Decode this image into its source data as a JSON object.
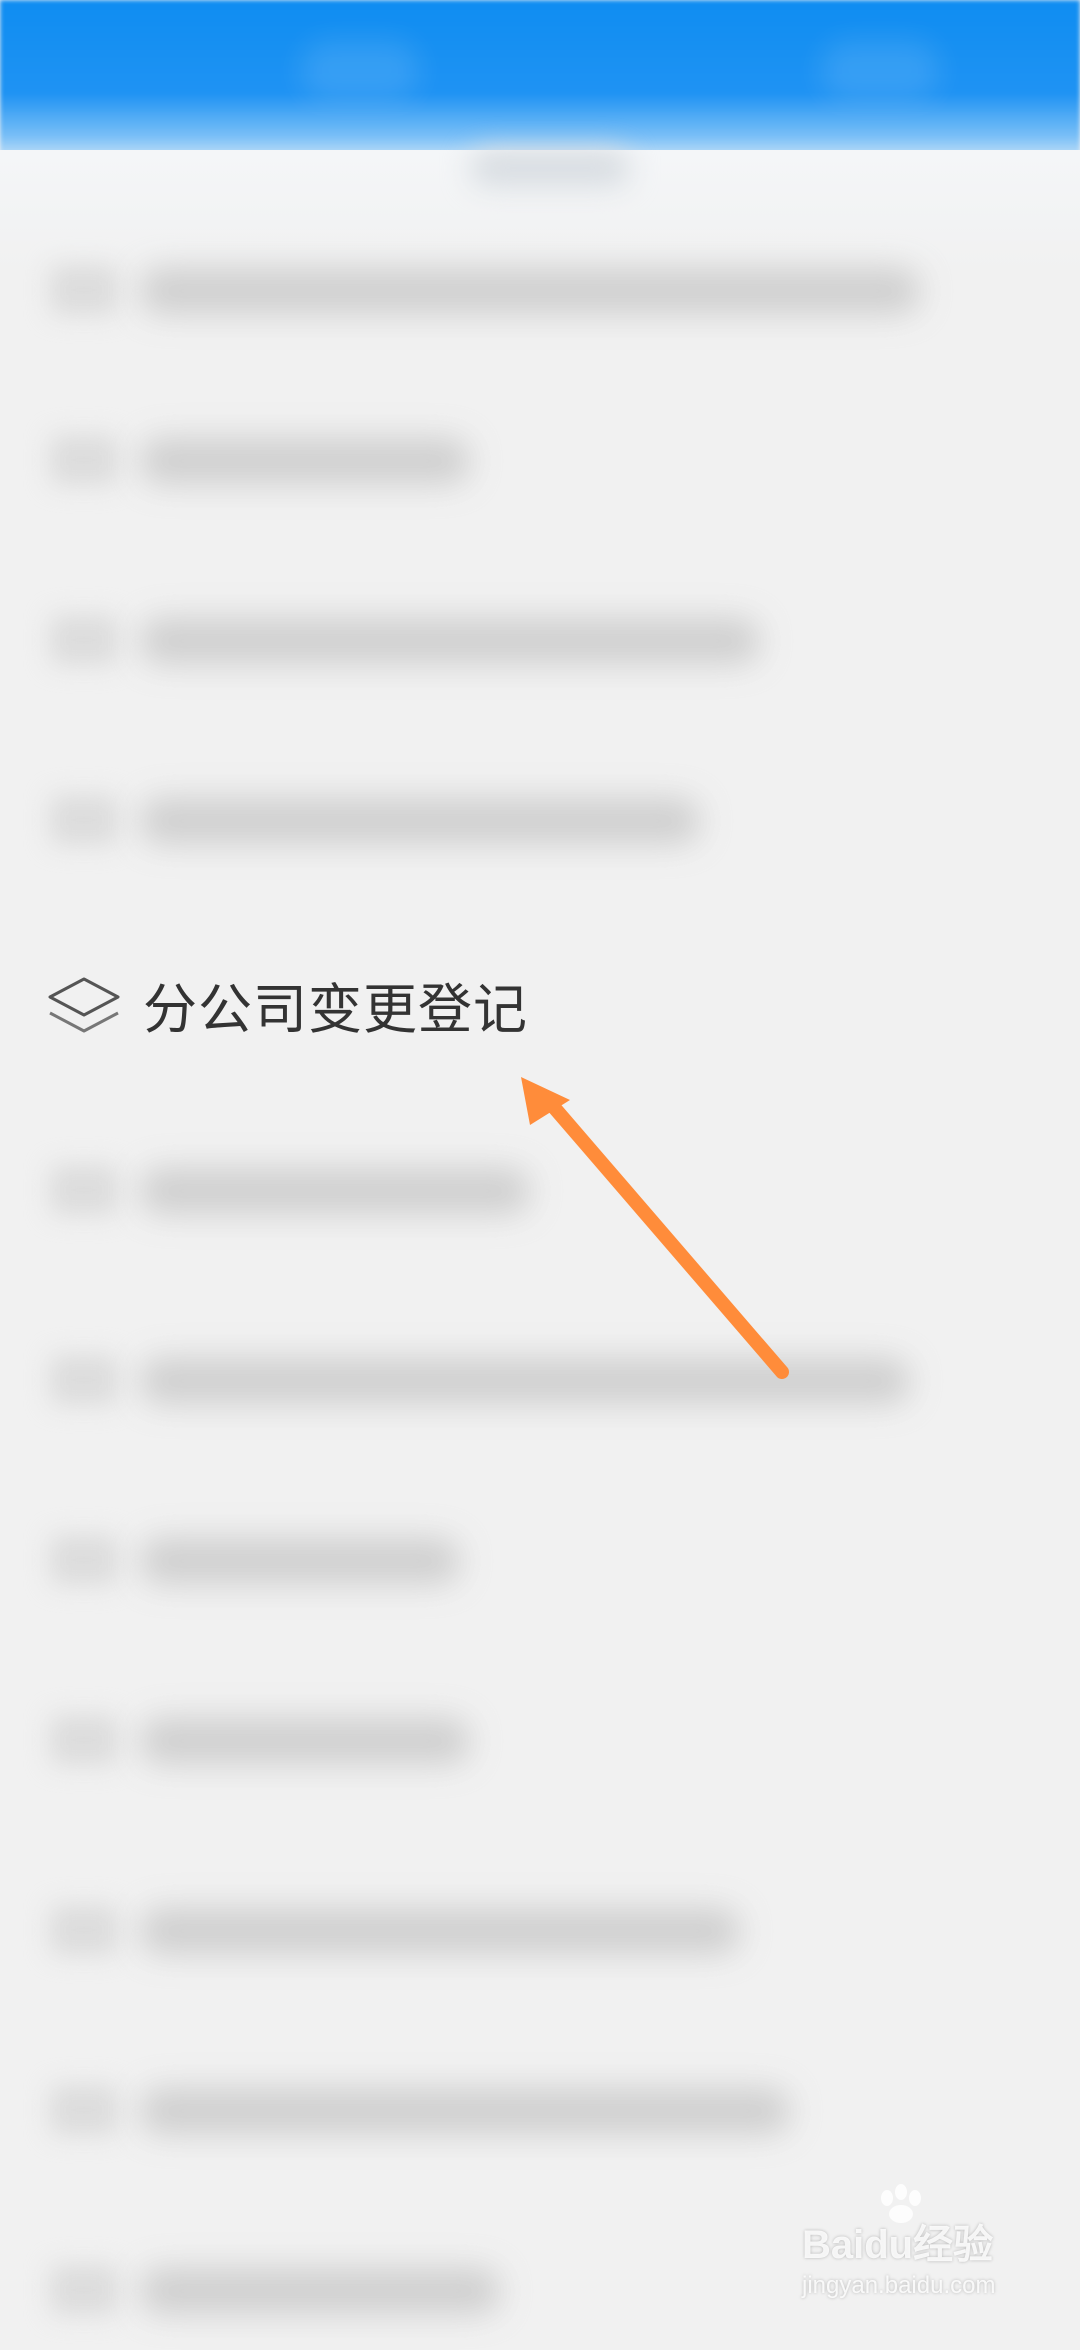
{
  "highlighted_item": {
    "label": "分公司变更登记",
    "icon": "layers-icon"
  },
  "annotation": {
    "arrow_color": "#ff8c3a"
  },
  "watermark": {
    "brand": "Baidu经验",
    "url": "jingyan.baidu.com"
  },
  "colors": {
    "header": "#1290f2",
    "background": "#f1f1f1"
  }
}
